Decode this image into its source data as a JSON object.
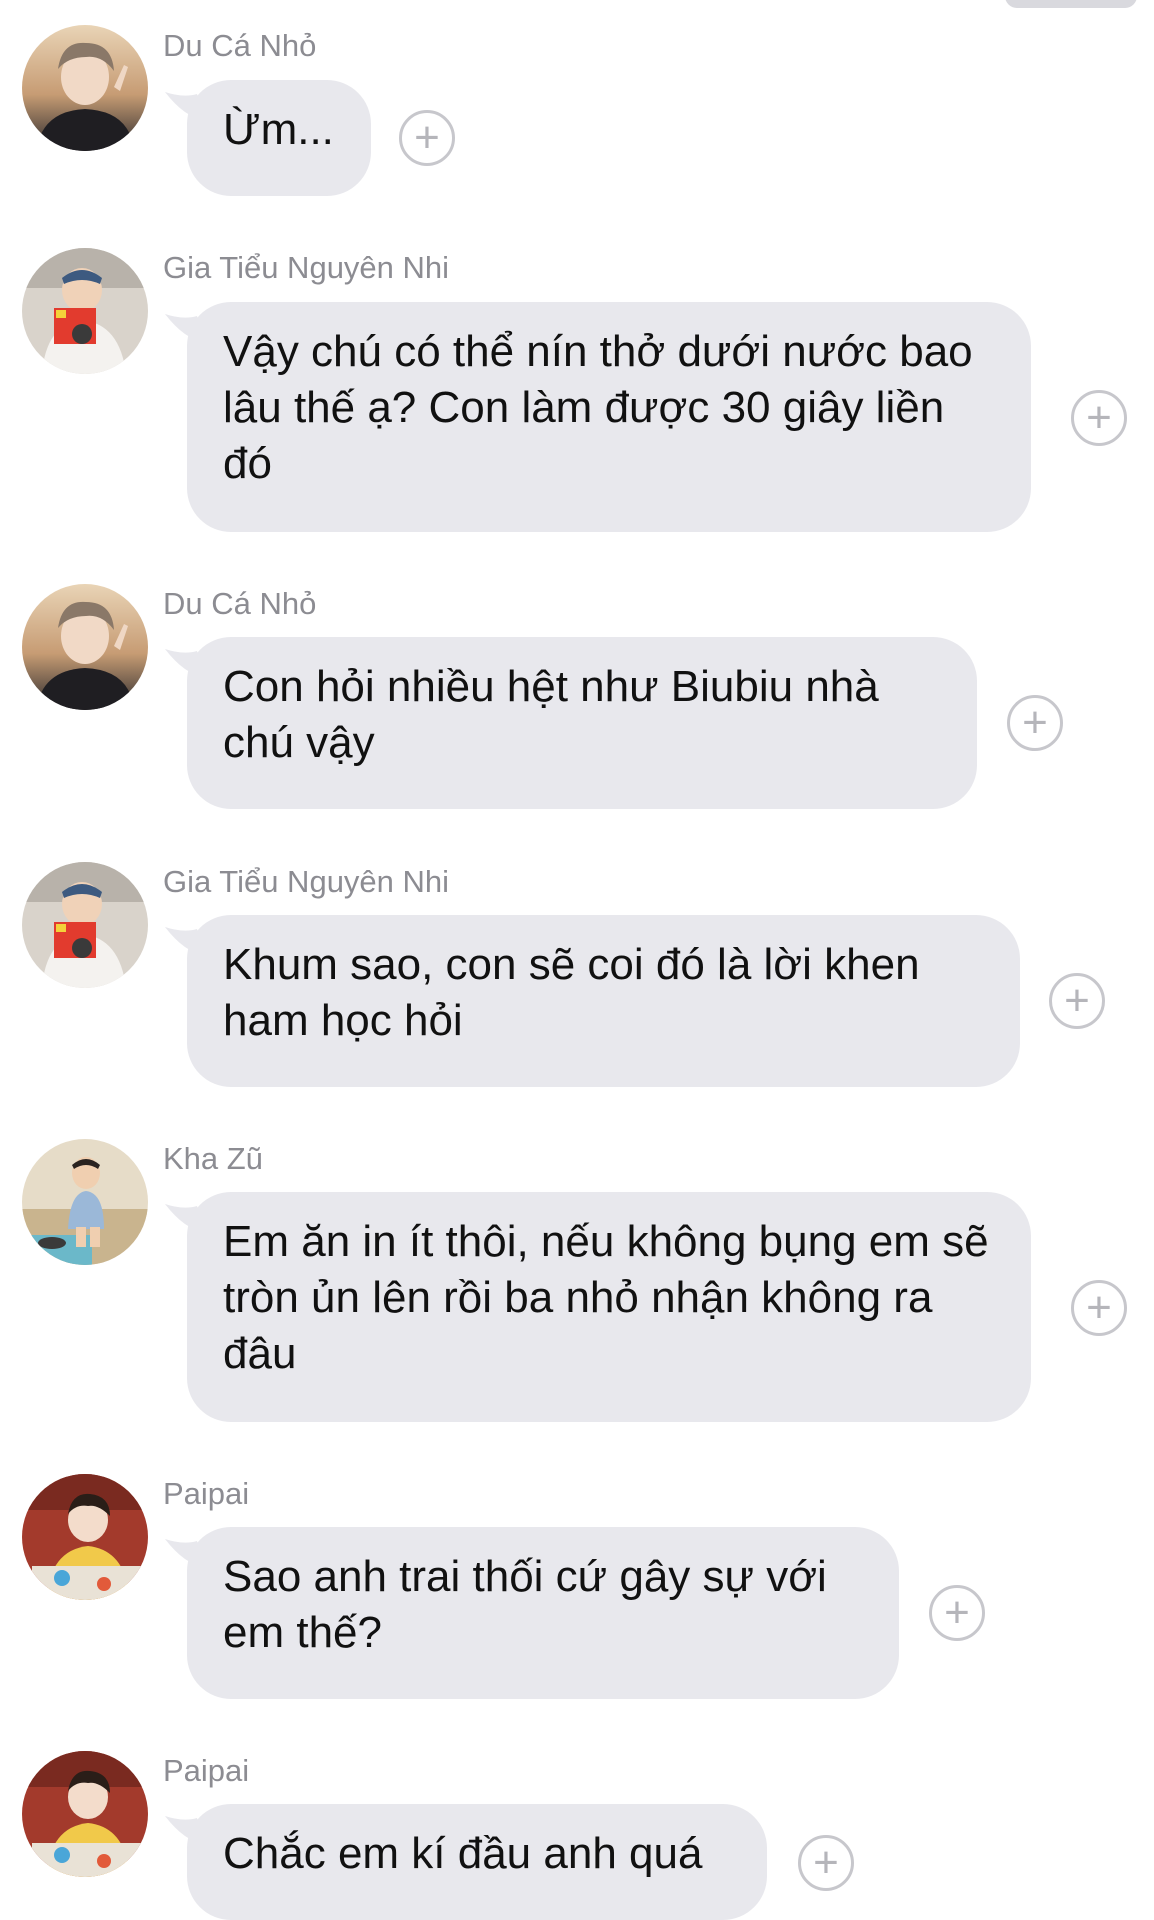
{
  "messages": [
    {
      "sender": "Du Cá Nhỏ",
      "avatar": "avatar-du-ca-nho",
      "text": "Ừm...",
      "add_icon": "+"
    },
    {
      "sender": "Gia Tiểu Nguyên Nhi",
      "avatar": "avatar-gia-tieu-nguyen-nhi",
      "text": "Vậy chú có thể nín thở dưới nước bao lâu thế ạ? Con làm được 30 giây liền đó",
      "add_icon": "+"
    },
    {
      "sender": "Du Cá Nhỏ",
      "avatar": "avatar-du-ca-nho",
      "text": "Con hỏi nhiều hệt như Biubiu nhà chú vậy",
      "add_icon": "+"
    },
    {
      "sender": "Gia Tiểu Nguyên Nhi",
      "avatar": "avatar-gia-tieu-nguyen-nhi",
      "text": "Khum sao, con sẽ coi đó là lời khen ham học hỏi",
      "add_icon": "+"
    },
    {
      "sender": "Kha Zũ",
      "avatar": "avatar-kha-zu",
      "text": "Em ăn in ít thôi, nếu không bụng em sẽ tròn ủn lên rồi ba nhỏ nhận không ra đâu",
      "add_icon": "+"
    },
    {
      "sender": "Paipai",
      "avatar": "avatar-paipai",
      "text": "Sao anh trai thối cứ gây sự với em thế?",
      "add_icon": "+"
    },
    {
      "sender": "Paipai",
      "avatar": "avatar-paipai",
      "text": "Chắc em kí đầu anh quá",
      "add_icon": "+"
    }
  ],
  "colors": {
    "bubble": "#e8e8ed",
    "sender_text": "#8c8c92",
    "message_text": "#111111",
    "add_button": "#c7c7cc"
  }
}
